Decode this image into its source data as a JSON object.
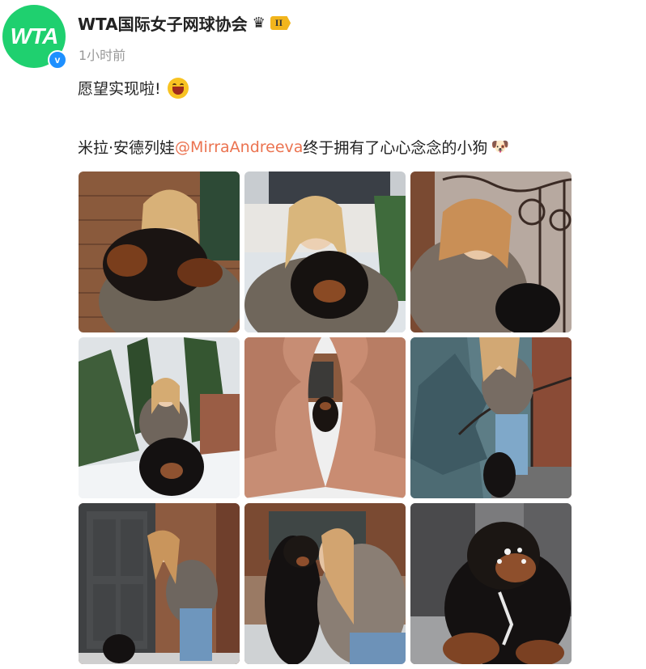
{
  "post": {
    "author": {
      "avatar_text": "WTA",
      "name": "WTA国际女子网球协会",
      "verified_mark": "v",
      "rank_badge": "II",
      "crown_icon": "crown-icon"
    },
    "timestamp": "1小时前",
    "text_line1": "愿望实现啦!",
    "text_line2_before": "米拉·安德列娃",
    "mention": "@MirraAndreeva",
    "text_line2_after": " 终于拥有了心心念念的小狗",
    "dog_emoji": "🐶"
  },
  "colors": {
    "avatar_bg": "#1fd06f",
    "mention": "#eb7350",
    "timestamp": "#999999",
    "verified": "#1e90ff",
    "rank_badge": "#f2b51c"
  },
  "photos": [
    {
      "label": "photo-1",
      "scene": "girl holding black-brown puppy by wooden wall"
    },
    {
      "label": "photo-2",
      "scene": "girl hugging puppy in front of house"
    },
    {
      "label": "photo-3",
      "scene": "girl on stairs with puppy near iron railing"
    },
    {
      "label": "photo-4",
      "scene": "girl crouching in snowy garden with puppy"
    },
    {
      "label": "photo-5",
      "scene": "hands forming heart framing puppy"
    },
    {
      "label": "photo-6",
      "scene": "girl on steps beside fir tree with puppy"
    },
    {
      "label": "photo-7",
      "scene": "girl bending near dark door with puppy"
    },
    {
      "label": "photo-8",
      "scene": "girl kissing puppy"
    },
    {
      "label": "photo-9",
      "scene": "close-up of puppy with snow"
    }
  ]
}
